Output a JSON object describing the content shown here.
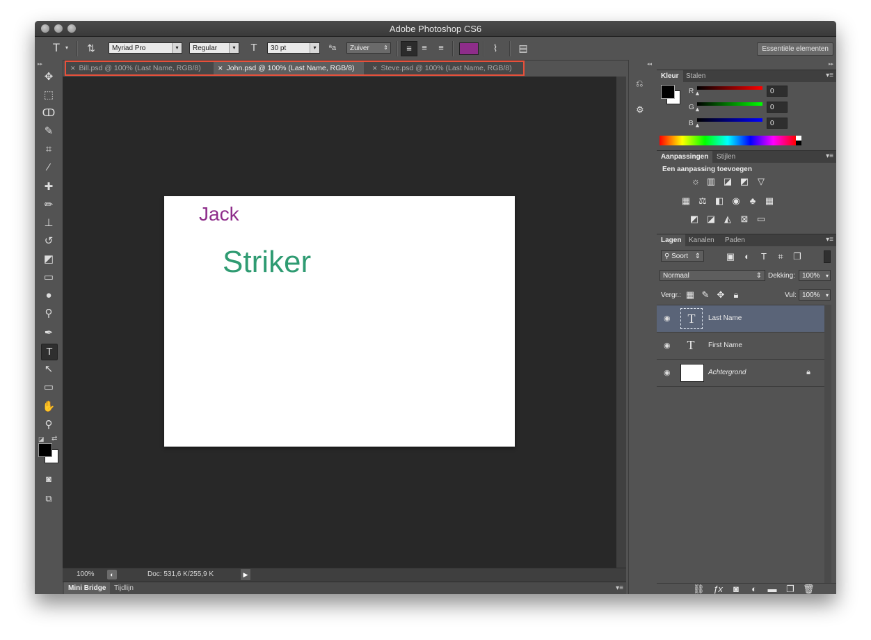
{
  "window": {
    "title": "Adobe Photoshop CS6"
  },
  "options_bar": {
    "font_family": "Myriad Pro",
    "font_style": "Regular",
    "font_size": "30 pt",
    "antialias": "Zuiver",
    "text_color": "#8e2d8a",
    "workspace": "Essentiële elementen"
  },
  "doc_tabs": [
    {
      "label": "Bill.psd @ 100% (Last Name, RGB/8)",
      "active": false
    },
    {
      "label": "John.psd @ 100% (Last Name, RGB/8)",
      "active": true
    },
    {
      "label": "Steve.psd @ 100% (Last Name, RGB/8)",
      "active": false
    }
  ],
  "canvas": {
    "first_name_text": "Jack",
    "last_name_text": "Striker",
    "first_name_color": "#8e2d8a",
    "last_name_color": "#2f9b72"
  },
  "status": {
    "zoom": "100%",
    "doc_info": "Doc: 531,6 K/255,9 K"
  },
  "bottom_tabs": [
    "Mini Bridge",
    "Tijdlijn"
  ],
  "color_panel": {
    "tabs": [
      "Kleur",
      "Stalen"
    ],
    "channels": [
      {
        "label": "R",
        "value": "0"
      },
      {
        "label": "G",
        "value": "0"
      },
      {
        "label": "B",
        "value": "0"
      }
    ]
  },
  "adjustments_panel": {
    "tabs": [
      "Aanpassingen",
      "Stijlen"
    ],
    "heading": "Een aanpassing toevoegen"
  },
  "layers_panel": {
    "tabs": [
      "Lagen",
      "Kanalen",
      "Paden"
    ],
    "filter_kind": "Soort",
    "blend_mode": "Normaal",
    "opacity_label": "Dekking:",
    "opacity_value": "100%",
    "lock_label": "Vergr.:",
    "fill_label": "Vul:",
    "fill_value": "100%",
    "layers": [
      {
        "name": "Last Name",
        "type": "text",
        "selected": true
      },
      {
        "name": "First Name",
        "type": "text",
        "selected": false
      },
      {
        "name": "Achtergrond",
        "type": "background",
        "selected": false,
        "locked": true
      }
    ]
  }
}
